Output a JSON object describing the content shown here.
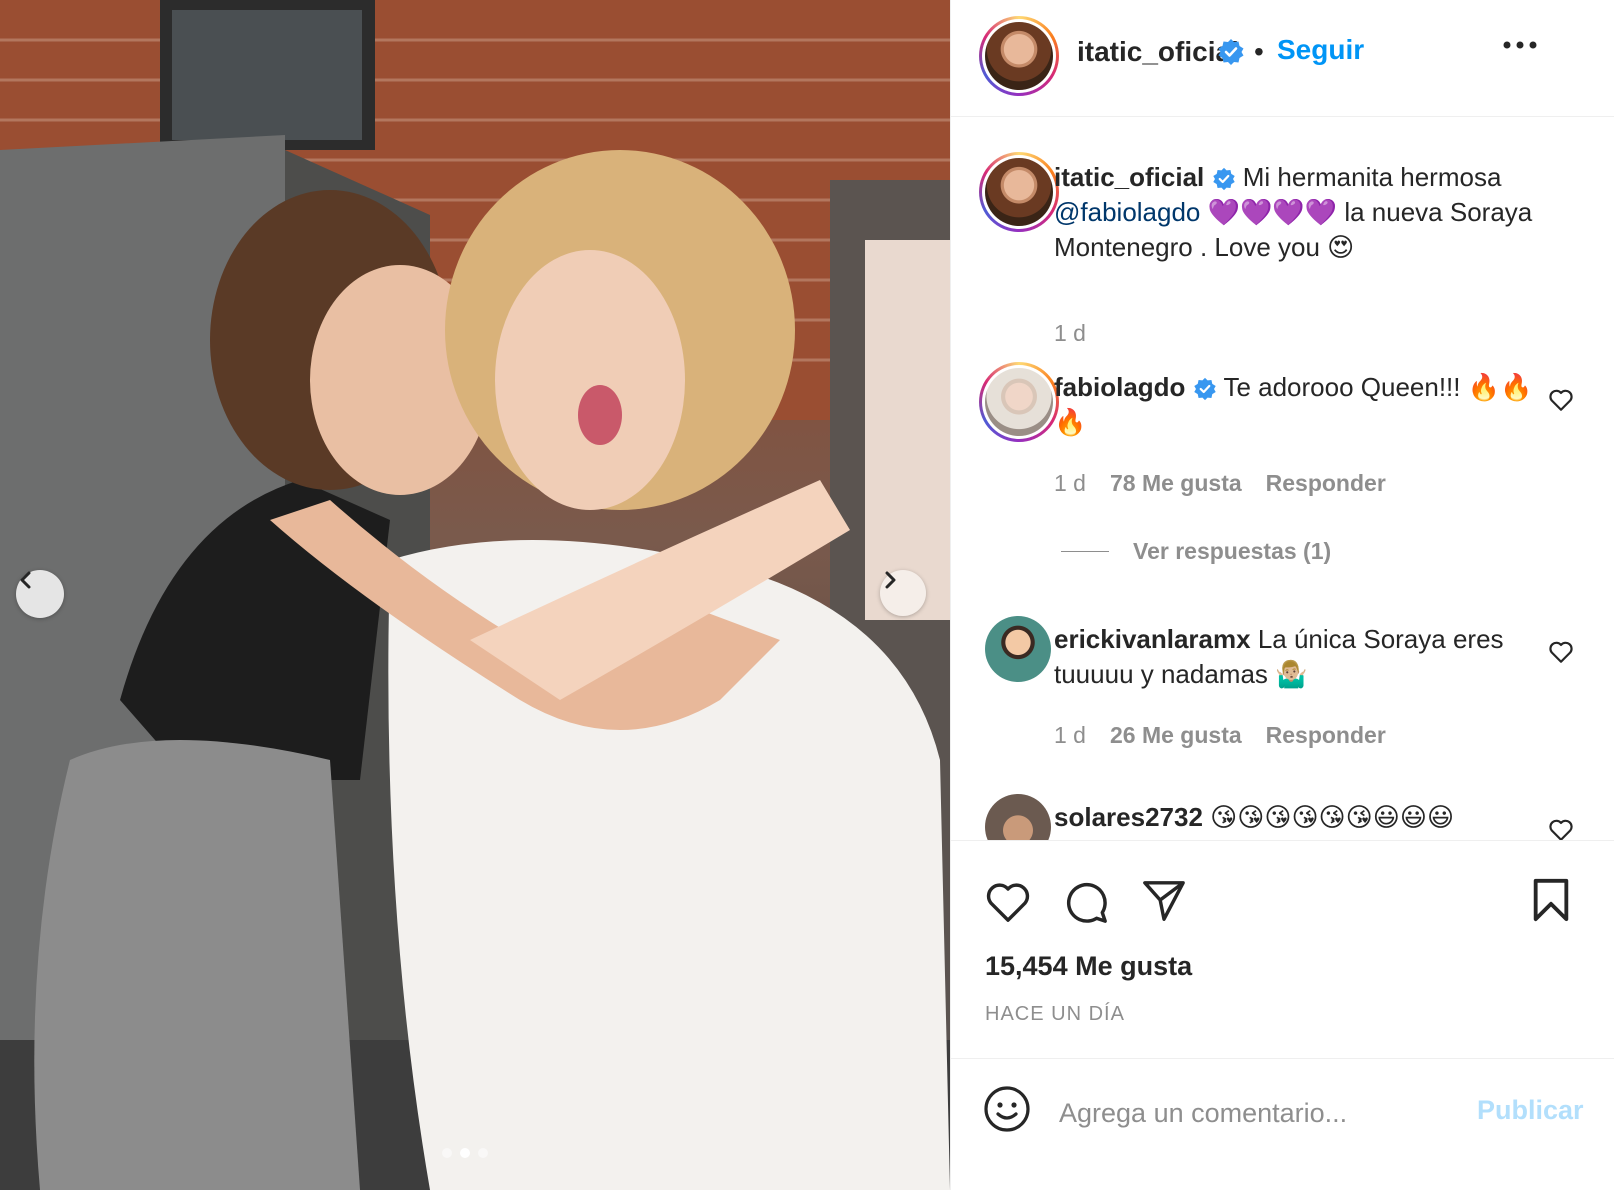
{
  "post": {
    "username": "itatic_oficial",
    "separator": "•",
    "follow_label": "Seguir",
    "image_count": 3,
    "active_image": 2
  },
  "caption": {
    "username": "itatic_oficial",
    "text_1": "Mi hermanita hermosa",
    "mention": "@fabiolagdo",
    "text_2": "💜💜💜💜 la nueva Soraya Montenegro . Love you 😍",
    "time": "1 d"
  },
  "comments": [
    {
      "username": "fabiolagdo",
      "text": "Te adorooo Queen!!! 🔥🔥🔥",
      "time": "1 d",
      "likes": "78 Me gusta",
      "reply": "Responder"
    },
    {
      "username": "erickivanlaramx",
      "text": "La única Soraya eres tuuuuu y nadamas 🤷🏼‍♂️",
      "time": "1 d",
      "likes": "26 Me gusta",
      "reply": "Responder"
    },
    {
      "username": "solares2732",
      "text": "😘😘😘😘😘😘😃😃😃"
    }
  ],
  "view_replies": "Ver respuestas (1)",
  "likes_total": "15,454 Me gusta",
  "posted_ago": "HACE UN DÍA",
  "composer": {
    "placeholder": "Agrega un comentario...",
    "publish_label": "Publicar"
  },
  "icons": {
    "verified": "verified-badge-icon",
    "like": "heart-icon",
    "comment": "comment-bubble-icon",
    "share": "paper-plane-icon",
    "save": "bookmark-icon",
    "emoji": "smiley-icon",
    "prev": "chevron-left-icon",
    "next": "chevron-right-icon",
    "more": "more-dots-icon"
  },
  "colors": {
    "link_blue": "#0095f6",
    "publish_disabled": "#b2dffc",
    "mention": "#00376b",
    "muted": "#8e8e8e",
    "verified": "#3897f0"
  }
}
